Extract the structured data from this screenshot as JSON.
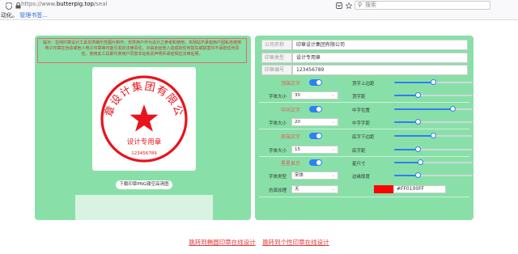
{
  "browser": {
    "url_scheme": "https://www.",
    "url_host": "butterpig.top",
    "url_path": "/seal",
    "search_placeholder": "搜索",
    "bookmarks_prefix": "动化。",
    "bookmarks_link": "管理书签..."
  },
  "notice": {
    "text": "提示：在线印章设计工具仅供娱乐性图片制作，仅供用户作为设计之参考和使用，本网站不承担用户因私自使用电子印章在伪造或他人电子印章等可能引发的法律责任，对由此给他人造成的任何损失或损害均不承担任何责任。使用此工具即代表用户同意本站免责声明并承担相应法律后果。"
  },
  "stamp": {
    "company": "印章设计集团有限公司",
    "seal_type": "设计专用章",
    "seal_number": "123456789",
    "color": "#FF0100"
  },
  "download_button": "下载印章PNG镂空高清图",
  "info": [
    {
      "label": "公司名称",
      "value": "印章设计集团有限公司"
    },
    {
      "label": "印章类型",
      "value": "设计专用章"
    },
    {
      "label": "印章编号",
      "value": "123456789"
    }
  ],
  "sections": {
    "top_text": {
      "label": "顶端文字",
      "size_label": "字体大小",
      "size_value": "30",
      "sliders": [
        {
          "label": "顶字上边距",
          "value": 0.5
        },
        {
          "label": "顶字距",
          "value": 0.3
        }
      ]
    },
    "mid_text": {
      "label": "中间文字",
      "size_label": "字体大小",
      "size_value": "20",
      "sliders": [
        {
          "label": "中字位置",
          "value": 0.75
        },
        {
          "label": "中字字距",
          "value": 0.3
        }
      ]
    },
    "bottom_text": {
      "label": "底端文字",
      "size_label": "字体大小",
      "size_value": "15",
      "sliders": [
        {
          "label": "底字下边距",
          "value": 0.5
        },
        {
          "label": "底字距",
          "value": 0.3
        }
      ]
    },
    "star": {
      "label": "星星显示",
      "font_label": "字体类型",
      "font_value": "宋体",
      "sliders": [
        {
          "label": "星尺寸",
          "value": 0.33
        },
        {
          "label": "边缘厚度",
          "value": 0.3
        }
      ]
    }
  },
  "texture": {
    "label": "仿真纹理",
    "value": "无"
  },
  "color_hex": "#FF0100FF",
  "footer": {
    "link1": "跳转到椭圆印章在线设计",
    "link2": "跳转到个性印章在线设计"
  }
}
